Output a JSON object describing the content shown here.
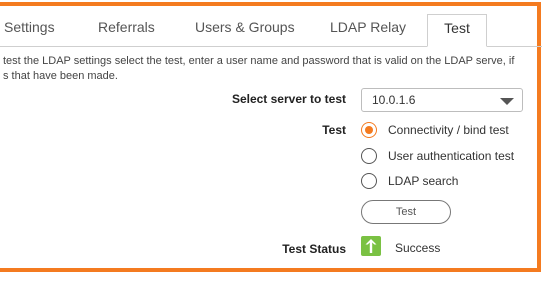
{
  "tabs": [
    {
      "label": "Settings"
    },
    {
      "label": "Referrals"
    },
    {
      "label": "Users & Groups"
    },
    {
      "label": "LDAP Relay"
    },
    {
      "label": "Test"
    }
  ],
  "active_tab": "Test",
  "description_line1": "test the LDAP settings select the test, enter a user name and password that is valid on the LDAP serve, if",
  "description_line2": "s that have been made.",
  "server_select": {
    "label": "Select server to test",
    "value": "10.0.1.6"
  },
  "test_options": {
    "label": "Test",
    "options": [
      {
        "label": "Connectivity / bind test",
        "checked": true
      },
      {
        "label": "User authentication test",
        "checked": false
      },
      {
        "label": "LDAP search",
        "checked": false
      }
    ]
  },
  "test_button": {
    "label": "Test"
  },
  "test_status": {
    "label": "Test Status",
    "value": "Success",
    "icon": "arrow-up-icon",
    "color": "#7ac143"
  },
  "colors": {
    "accent": "#f47b20",
    "success": "#7ac143"
  }
}
